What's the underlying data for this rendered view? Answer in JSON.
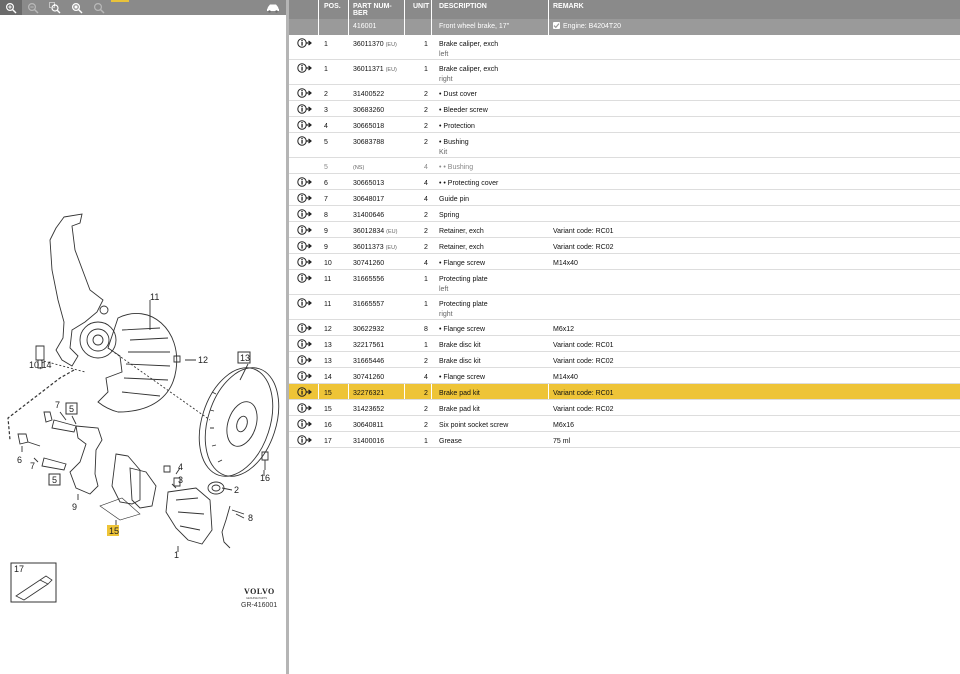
{
  "toolbar": {
    "icons": [
      "zoom-in-icon",
      "zoom-out-icon",
      "zoom-area-icon",
      "zoom-fit-icon",
      "zoom-reset-icon",
      "car-icon"
    ]
  },
  "diagram": {
    "labels": [
      "11",
      "12",
      "13",
      "10,14",
      "5",
      "7",
      "6",
      "7",
      "5",
      "9",
      "4",
      "3",
      "2",
      "8",
      "1",
      "15",
      "16"
    ],
    "legend_number": "17",
    "brand": "VOLVO",
    "brand_sub": "GENUINE PARTS",
    "code": "GR-416001"
  },
  "table": {
    "headers": {
      "pos": "POS.",
      "part_number": "PART NUM-BER",
      "unit": "UNIT",
      "description": "DESCRIPTION",
      "remark": "REMARK"
    },
    "group": {
      "code": "416001",
      "description": "Front wheel brake, 17\"",
      "remark": "Engine: B4204T20"
    },
    "rows": [
      {
        "pos": "1",
        "part": "36011370",
        "tag": "(EU)",
        "unit": "1",
        "desc": "Brake caliper, exch",
        "sub": "left",
        "remark": "",
        "icon": true,
        "selected": false,
        "grey": false
      },
      {
        "pos": "1",
        "part": "36011371",
        "tag": "(EU)",
        "unit": "1",
        "desc": "Brake caliper, exch",
        "sub": "right",
        "remark": "",
        "icon": true,
        "selected": false,
        "grey": false
      },
      {
        "pos": "2",
        "part": "31400522",
        "tag": "",
        "unit": "2",
        "desc": "•  Dust cover",
        "sub": "",
        "remark": "",
        "icon": true,
        "selected": false,
        "grey": false
      },
      {
        "pos": "3",
        "part": "30683260",
        "tag": "",
        "unit": "2",
        "desc": "•  Bleeder screw",
        "sub": "",
        "remark": "",
        "icon": true,
        "selected": false,
        "grey": false
      },
      {
        "pos": "4",
        "part": "30665018",
        "tag": "",
        "unit": "2",
        "desc": "•  Protection",
        "sub": "",
        "remark": "",
        "icon": true,
        "selected": false,
        "grey": false
      },
      {
        "pos": "5",
        "part": "30683788",
        "tag": "",
        "unit": "2",
        "desc": "•  Bushing",
        "sub": "Kit",
        "remark": "",
        "icon": true,
        "selected": false,
        "grey": false
      },
      {
        "pos": "5",
        "part": "",
        "tag": "(NS)",
        "unit": "4",
        "desc": "•  •  Bushing",
        "sub": "",
        "remark": "",
        "icon": false,
        "selected": false,
        "grey": true
      },
      {
        "pos": "6",
        "part": "30665013",
        "tag": "",
        "unit": "4",
        "desc": "•  •  Protecting cover",
        "sub": "",
        "remark": "",
        "icon": true,
        "selected": false,
        "grey": false
      },
      {
        "pos": "7",
        "part": "30648017",
        "tag": "",
        "unit": "4",
        "desc": "Guide pin",
        "sub": "",
        "remark": "",
        "icon": true,
        "selected": false,
        "grey": false
      },
      {
        "pos": "8",
        "part": "31400646",
        "tag": "",
        "unit": "2",
        "desc": "Spring",
        "sub": "",
        "remark": "",
        "icon": true,
        "selected": false,
        "grey": false
      },
      {
        "pos": "9",
        "part": "36012834",
        "tag": "(EU)",
        "unit": "2",
        "desc": "Retainer, exch",
        "sub": "",
        "remark": "Variant code: RC01",
        "icon": true,
        "selected": false,
        "grey": false
      },
      {
        "pos": "9",
        "part": "36011373",
        "tag": "(EU)",
        "unit": "2",
        "desc": "Retainer, exch",
        "sub": "",
        "remark": "Variant code: RC02",
        "icon": true,
        "selected": false,
        "grey": false
      },
      {
        "pos": "10",
        "part": "30741260",
        "tag": "",
        "unit": "4",
        "desc": "•  Flange screw",
        "sub": "",
        "remark": "M14x40",
        "icon": true,
        "selected": false,
        "grey": false
      },
      {
        "pos": "11",
        "part": "31665556",
        "tag": "",
        "unit": "1",
        "desc": "Protecting plate",
        "sub": "left",
        "remark": "",
        "icon": true,
        "selected": false,
        "grey": false
      },
      {
        "pos": "11",
        "part": "31665557",
        "tag": "",
        "unit": "1",
        "desc": "Protecting plate",
        "sub": "right",
        "remark": "",
        "icon": true,
        "selected": false,
        "grey": false
      },
      {
        "pos": "12",
        "part": "30622932",
        "tag": "",
        "unit": "8",
        "desc": "•  Flange screw",
        "sub": "",
        "remark": "M6x12",
        "icon": true,
        "selected": false,
        "grey": false
      },
      {
        "pos": "13",
        "part": "32217561",
        "tag": "",
        "unit": "1",
        "desc": "Brake disc kit",
        "sub": "",
        "remark": "Variant code: RC01",
        "icon": true,
        "selected": false,
        "grey": false
      },
      {
        "pos": "13",
        "part": "31665446",
        "tag": "",
        "unit": "2",
        "desc": "Brake disc kit",
        "sub": "",
        "remark": "Variant code: RC02",
        "icon": true,
        "selected": false,
        "grey": false
      },
      {
        "pos": "14",
        "part": "30741260",
        "tag": "",
        "unit": "4",
        "desc": "•  Flange screw",
        "sub": "",
        "remark": "M14x40",
        "icon": true,
        "selected": false,
        "grey": false
      },
      {
        "pos": "15",
        "part": "32276321",
        "tag": "",
        "unit": "2",
        "desc": "Brake pad kit",
        "sub": "",
        "remark": "Variant code: RC01",
        "icon": true,
        "selected": true,
        "grey": false
      },
      {
        "pos": "15",
        "part": "31423652",
        "tag": "",
        "unit": "2",
        "desc": "Brake pad kit",
        "sub": "",
        "remark": "Variant code: RC02",
        "icon": true,
        "selected": false,
        "grey": false
      },
      {
        "pos": "16",
        "part": "30640811",
        "tag": "",
        "unit": "2",
        "desc": "Six point socket screw",
        "sub": "",
        "remark": "M6x16",
        "icon": true,
        "selected": false,
        "grey": false
      },
      {
        "pos": "17",
        "part": "31400016",
        "tag": "",
        "unit": "1",
        "desc": "Grease",
        "sub": "",
        "remark": "75 ml",
        "icon": true,
        "selected": false,
        "grey": false
      }
    ]
  },
  "colors": {
    "header_bg": "#8a8a8a",
    "group_bg": "#9a9a9a",
    "selected_bg": "#eec437",
    "accent": "#e8c23a"
  }
}
